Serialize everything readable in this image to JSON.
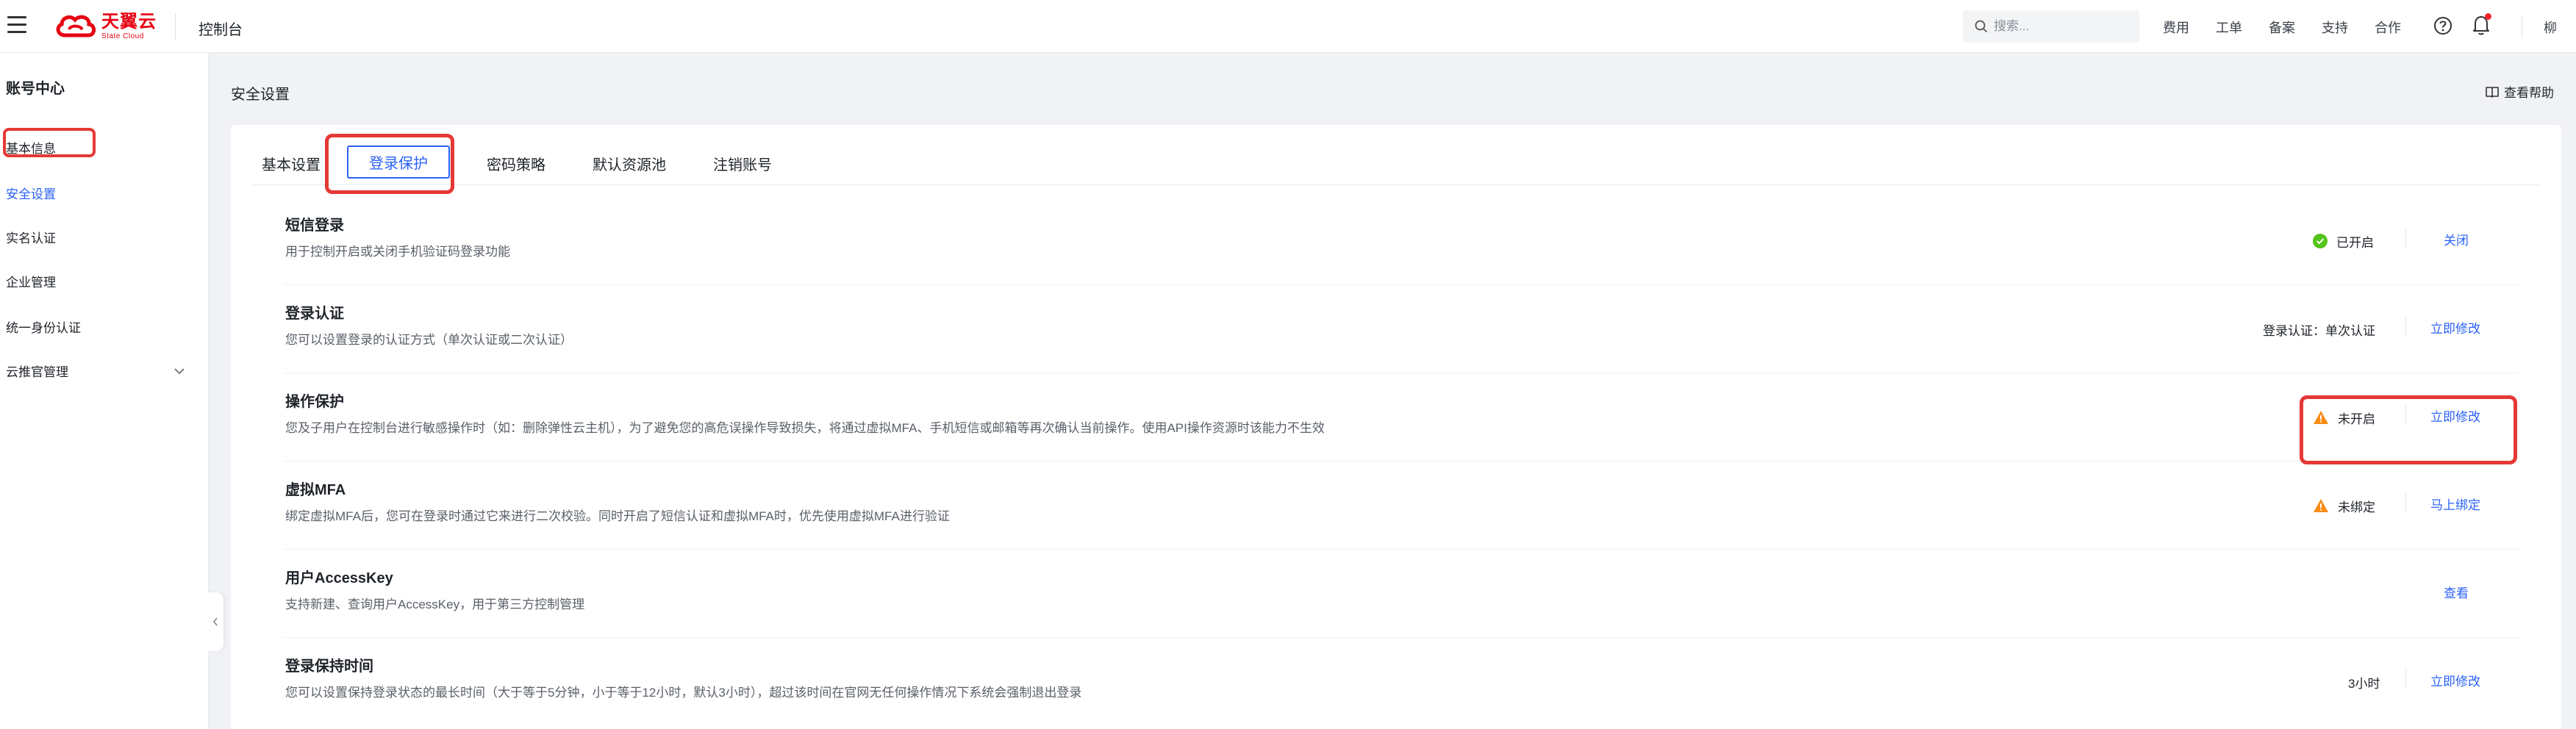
{
  "header": {
    "logo_cn": "天翼云",
    "logo_en": "State Cloud",
    "console_title": "控制台",
    "search_placeholder": "搜索...",
    "nav": [
      "费用",
      "工单",
      "备案",
      "支持",
      "合作"
    ],
    "user_name": "柳"
  },
  "sidebar": {
    "title": "账号中心",
    "items": [
      {
        "label": "基本信息"
      },
      {
        "label": "安全设置",
        "active": true
      },
      {
        "label": "实名认证"
      },
      {
        "label": "企业管理"
      },
      {
        "label": "统一身份认证"
      },
      {
        "label": "云推官管理"
      }
    ]
  },
  "main": {
    "page_title": "安全设置",
    "help_link": "查看帮助",
    "tabs": [
      {
        "label": "基本设置"
      },
      {
        "label": "登录保护",
        "active": true
      },
      {
        "label": "密码策略"
      },
      {
        "label": "默认资源池"
      },
      {
        "label": "注销账号"
      }
    ],
    "rows": [
      {
        "title": "短信登录",
        "desc": "用于控制开启或关闭手机验证码登录功能",
        "status": "已开启",
        "status_icon": "check-circle-icon",
        "action": "关闭"
      },
      {
        "title": "登录认证",
        "desc": "您可以设置登录的认证方式（单次认证或二次认证）",
        "status": "登录认证：单次认证",
        "action": "立即修改"
      },
      {
        "title": "操作保护",
        "desc": "您及子用户在控制台进行敏感操作时（如：删除弹性云主机），为了避免您的高危误操作导致损失，将通过虚拟MFA、手机短信或邮箱等再次确认当前操作。使用API操作资源时该能力不生效",
        "status": "未开启",
        "status_icon": "warning-icon",
        "action": "立即修改"
      },
      {
        "title": "虚拟MFA",
        "desc": "绑定虚拟MFA后，您可在登录时通过它来进行二次校验。同时开启了短信认证和虚拟MFA时，优先使用虚拟MFA进行验证",
        "status": "未绑定",
        "status_icon": "warning-icon",
        "action": "马上绑定"
      },
      {
        "title": "用户AccessKey",
        "desc": "支持新建、查询用户AccessKey，用于第三方控制管理",
        "status": "",
        "action": "查看"
      },
      {
        "title": "登录保持时间",
        "desc": "您可以设置保持登录状态的最长时间（大于等于5分钟，小于等于12小时，默认3小时），超过该时间在官网无任何操作情况下系统会强制退出登录",
        "status": "3小时",
        "action": "立即修改"
      }
    ]
  },
  "colors": {
    "accent": "#2b62f6",
    "success": "#52c41a",
    "warning": "#fa8c16",
    "highlight": "#e53935",
    "brand": "#e60012"
  }
}
